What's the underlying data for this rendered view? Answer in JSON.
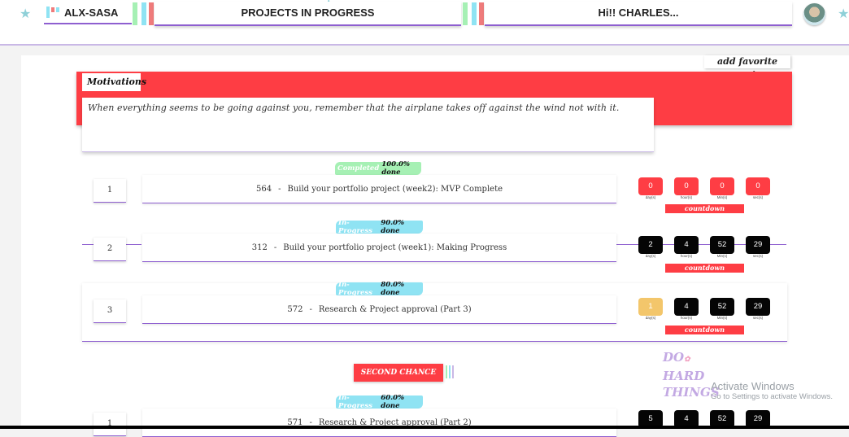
{
  "header": {
    "brand": "ALX-SASA",
    "center_title": "PROJECTS IN PROGRESS",
    "greeting": "Hi!! CHARLES...",
    "avatar_icon": "user-avatar",
    "star_icon": "star-icon",
    "colors": {
      "teal": "#8fe3f3",
      "green": "#a6f0b4",
      "red": "#ef7b7b",
      "purple": "#8e5fd0"
    }
  },
  "motivations": {
    "add_quote_label": "add favorite quote",
    "title": "Motivations",
    "quote": "When everything seems to be going against you, remember that the airplane takes off against the wind not with it."
  },
  "countdown_labels": {
    "days": "day(s)",
    "hours": "hour(s)",
    "mins": "Min(s)",
    "secs": "sec(s)"
  },
  "countdown_button": "countdown",
  "projects": [
    {
      "num": "1",
      "id": "564",
      "sep": "-",
      "title": "Build your portfolio project (week2): MVP Complete",
      "status": "Completed",
      "percent": "100.0% done",
      "status_color": "#a6f0b4",
      "days": "0",
      "hours": "0",
      "mins": "0",
      "secs": "0"
    },
    {
      "num": "2",
      "id": "312",
      "sep": "-",
      "title": "Build your portfolio project (week1): Making Progress",
      "status": "In-Progress",
      "percent": "90.0% done",
      "status_color": "#8fe3f3",
      "days": "2",
      "hours": "4",
      "mins": "52",
      "secs": "29"
    },
    {
      "num": "3",
      "id": "572",
      "sep": "-",
      "title": "Research & Project approval (Part 3)",
      "status": "In-Progress",
      "percent": "80.0% done",
      "status_color": "#8fe3f3",
      "days": "1",
      "hours": "4",
      "mins": "52",
      "secs": "29"
    }
  ],
  "second_chance": {
    "label": "SECOND CHANCE",
    "project": {
      "num": "1",
      "id": "571",
      "sep": "-",
      "title": "Research & Project approval (Part 2)",
      "status": "In-Progress",
      "percent": "60.0% done",
      "status_color": "#8fe3f3",
      "days": "5",
      "hours": "4",
      "mins": "52",
      "secs": "29"
    }
  },
  "slogan": {
    "line1": "DO",
    "line2": "HARD",
    "line3": "THINGS"
  },
  "watermark": {
    "line1": "Activate Windows",
    "line2": "Go to Settings to activate Windows."
  }
}
